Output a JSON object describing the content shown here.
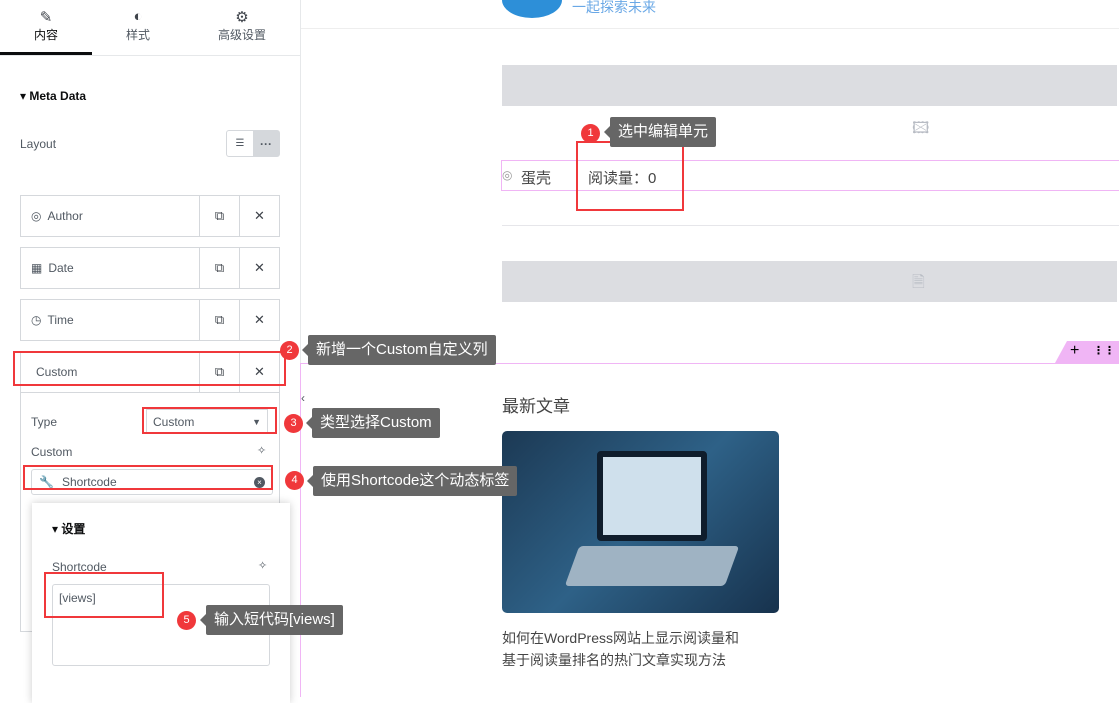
{
  "tabs": [
    {
      "label": "内容",
      "icon": "pencil-icon"
    },
    {
      "label": "样式",
      "icon": "contrast-icon"
    },
    {
      "label": "高级设置",
      "icon": "gear-icon"
    }
  ],
  "section_title": "Meta Data",
  "layout_label": "Layout",
  "items": [
    {
      "label": "Author",
      "icon": "user-circle-icon"
    },
    {
      "label": "Date",
      "icon": "calendar-icon"
    },
    {
      "label": "Time",
      "icon": "clock-icon"
    },
    {
      "label": "Custom",
      "icon": ""
    }
  ],
  "type_label": "Type",
  "type_value": "Custom",
  "custom_label": "Custom",
  "dynamic_tag": "Shortcode",
  "popup": {
    "title": "设置",
    "field_label": "Shortcode",
    "value": "[views]"
  },
  "annotations": [
    {
      "n": "1",
      "text": "选中编辑单元"
    },
    {
      "n": "2",
      "text": "新增一个Custom自定义列"
    },
    {
      "n": "3",
      "text": "类型选择Custom"
    },
    {
      "n": "4",
      "text": "使用Shortcode这个动态标签"
    },
    {
      "n": "5",
      "text": "输入短代码[views]"
    }
  ],
  "canvas": {
    "tagline": "一起探索未来",
    "author": "蛋壳",
    "views": "阅读量：0",
    "latest_title": "最新文章",
    "post_title_1": "如何在WordPress网站上显示阅读量和",
    "post_title_2": "基于阅读量排名的热门文章实现方法"
  },
  "colors": {
    "accent_red": "#f0383b",
    "selection_pink": "#f0b5f5",
    "tooltip": "#666666"
  }
}
